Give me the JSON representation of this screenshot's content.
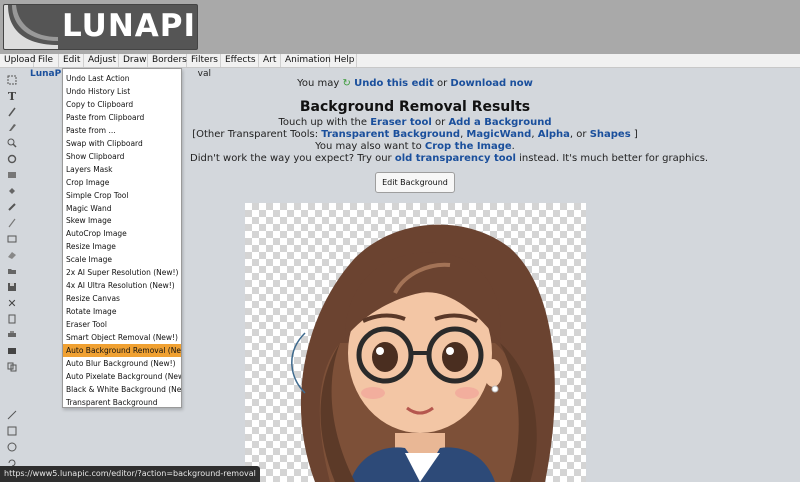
{
  "logo": {
    "text": "LUNAPIC"
  },
  "menu": [
    {
      "label": "Upload",
      "width": 34
    },
    {
      "label": "File",
      "width": 25
    },
    {
      "label": "Edit",
      "width": 25
    },
    {
      "label": "Adjust",
      "width": 35
    },
    {
      "label": "Draw",
      "width": 29
    },
    {
      "label": "Borders",
      "width": 39
    },
    {
      "label": "Filters",
      "width": 34
    },
    {
      "label": "Effects",
      "width": 38
    },
    {
      "label": "Art",
      "width": 22
    },
    {
      "label": "Animation",
      "width": 49
    },
    {
      "label": "Help",
      "width": 27
    }
  ],
  "site_link": {
    "prefix": "LunaPic",
    "suffix": "val"
  },
  "edit_menu": {
    "items": [
      "Undo Last Action",
      "Undo History List",
      "Copy to Clipboard",
      "Paste from Clipboard",
      "Paste from ...",
      "Swap with Clipboard",
      "Show Clipboard",
      "Layers Mask",
      "Crop Image",
      "Simple Crop Tool",
      "Magic Wand",
      "Skew Image",
      "AutoCrop Image",
      "Resize Image",
      "Scale Image",
      "2x AI Super Resolution (New!)",
      "4x AI Ultra Resolution (New!)",
      "Resize Canvas",
      "Rotate Image",
      "Eraser Tool",
      "Smart Object Removal (New!)",
      "Auto Background Removal (New!)",
      "Auto Blur Background (New!)",
      "Auto Pixelate Background (New!)",
      "Black & White Background (New!)",
      "Transparent Background"
    ],
    "highlighted_index": 21,
    "highlight_color": "#f0a132"
  },
  "content": {
    "undo_line": {
      "prefix": "You may",
      "undo": "Undo this edit",
      "or": "or",
      "download": "Download now"
    },
    "title": "Background Removal Results",
    "touchup": {
      "prefix": "Touch up with the",
      "eraser": "Eraser tool",
      "or": "or",
      "add_bg": "Add a Background"
    },
    "other_tools": {
      "prefix": "[Other Transparent Tools:",
      "t1": "Transparent Background",
      "t2": "MagicWand",
      "t3": "Alpha",
      "or": ", or",
      "t4": "Shapes",
      "suffix": "]"
    },
    "crop_line": {
      "prefix": "You may also want to",
      "crop": "Crop the Image",
      "suffix": "."
    },
    "didnt_work": {
      "prefix": "Didn't work the way you expect? Try our",
      "tool": "old transparency tool",
      "suffix": "instead. It's much better for graphics."
    },
    "edit_bg_button": "Edit Background"
  },
  "status_url": "https://www5.lunapic.com/editor/?action=background-removal",
  "colors": {
    "link": "#1a4f9c",
    "header": "#a9a9a9",
    "page_bg": "#d3d7dc"
  }
}
